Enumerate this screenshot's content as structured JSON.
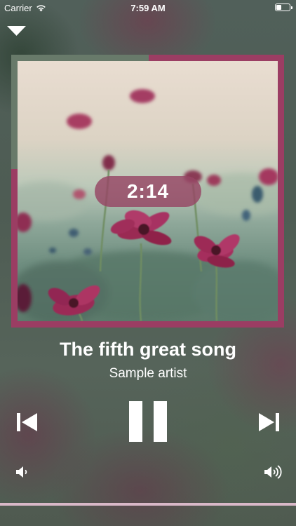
{
  "status_bar": {
    "carrier": "Carrier",
    "time": "7:59 AM",
    "battery_level": 0.45
  },
  "player": {
    "elapsed": "2:14",
    "title": "The fifth great song",
    "artist": "Sample artist",
    "state": "playing",
    "progress": 1.0
  },
  "icons": {
    "collapse": "chevron-down-icon",
    "previous": "skip-back-icon",
    "pause": "pause-icon",
    "next": "skip-forward-icon",
    "volume_low": "speaker-low-icon",
    "volume_high": "speaker-high-icon"
  },
  "colors": {
    "accent": "#9b3d63",
    "frame_corner": "#687a6a",
    "progress": "#d9b8c8"
  }
}
